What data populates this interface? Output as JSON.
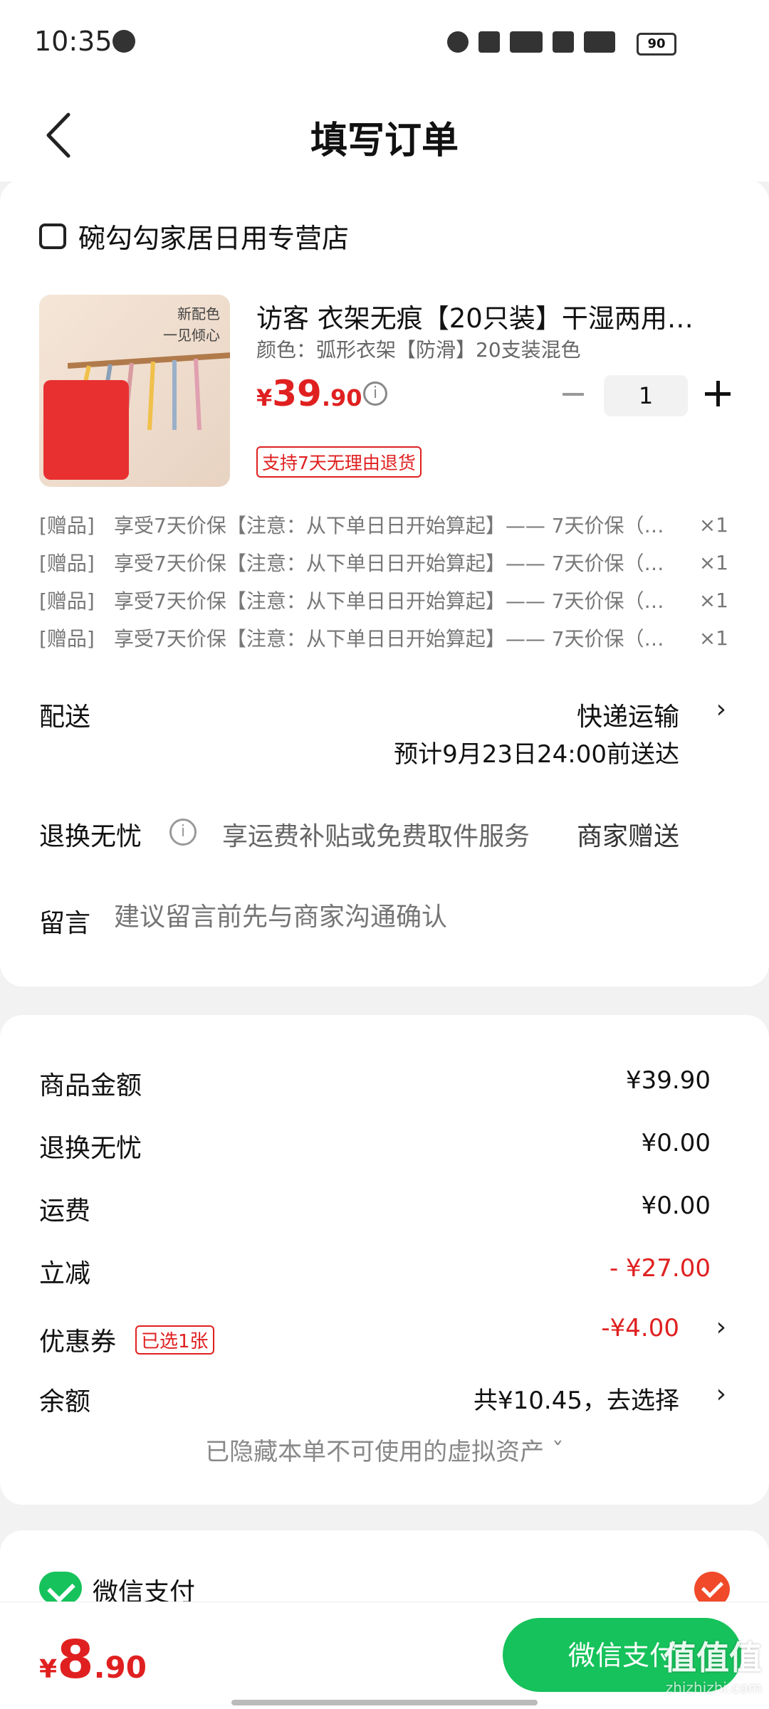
{
  "status": {
    "time": "10:35",
    "battery": "90"
  },
  "header": {
    "title": "填写订单"
  },
  "store": {
    "name": "碗勾勾家居日用专营店"
  },
  "product": {
    "image_caption_1": "新配色",
    "image_caption_2": "一见倾心",
    "title": "访客 衣架无痕【20只装】干湿两用…",
    "variant": "颜色：弧形衣架【防滑】20支装混色",
    "price_currency": "¥",
    "price_int": "39",
    "price_dec": ".90",
    "quantity": "1",
    "return_badge": "支持7天无理由退货"
  },
  "gifts": [
    {
      "tag": "[赠品]",
      "text": "享受7天价保【注意：从下单日日开始算起】—— 7天价保（…",
      "qty": "×1"
    },
    {
      "tag": "[赠品]",
      "text": "享受7天价保【注意：从下单日日开始算起】—— 7天价保（…",
      "qty": "×1"
    },
    {
      "tag": "[赠品]",
      "text": "享受7天价保【注意：从下单日日开始算起】—— 7天价保（…",
      "qty": "×1"
    },
    {
      "tag": "[赠品]",
      "text": "享受7天价保【注意：从下单日日开始算起】—— 7天价保（…",
      "qty": "×1"
    }
  ],
  "delivery": {
    "label": "配送",
    "method": "快递运输",
    "estimate": "预计9月23日24:00前送达"
  },
  "return_service": {
    "label": "退换无忧",
    "description": "享运费补贴或免费取件服务",
    "provider": "商家赠送"
  },
  "message": {
    "label": "留言",
    "placeholder": "建议留言前先与商家沟通确认"
  },
  "summary": {
    "goods_label": "商品金额",
    "goods_value": "¥39.90",
    "return_label": "退换无忧",
    "return_value": "¥0.00",
    "shipping_label": "运费",
    "shipping_value": "¥0.00",
    "discount_label": "立减",
    "discount_value": "- ¥27.00",
    "coupon_label": "优惠券",
    "coupon_badge": "已选1张",
    "coupon_value": "-¥4.00",
    "balance_label": "余额",
    "balance_value": "共¥10.45，去选择",
    "hidden_assets": "已隐藏本单不可使用的虚拟资产 ˇ"
  },
  "payment": {
    "method": "微信支付"
  },
  "bottom": {
    "total_currency": "¥",
    "total_int": "8",
    "total_dec": ".90",
    "submit": "微信支付",
    "watermark": "值值值",
    "watermark_url": "zhizhizhi.com"
  },
  "colors": {
    "accent_red": "#e02020",
    "wechat_green": "#16c25b"
  }
}
